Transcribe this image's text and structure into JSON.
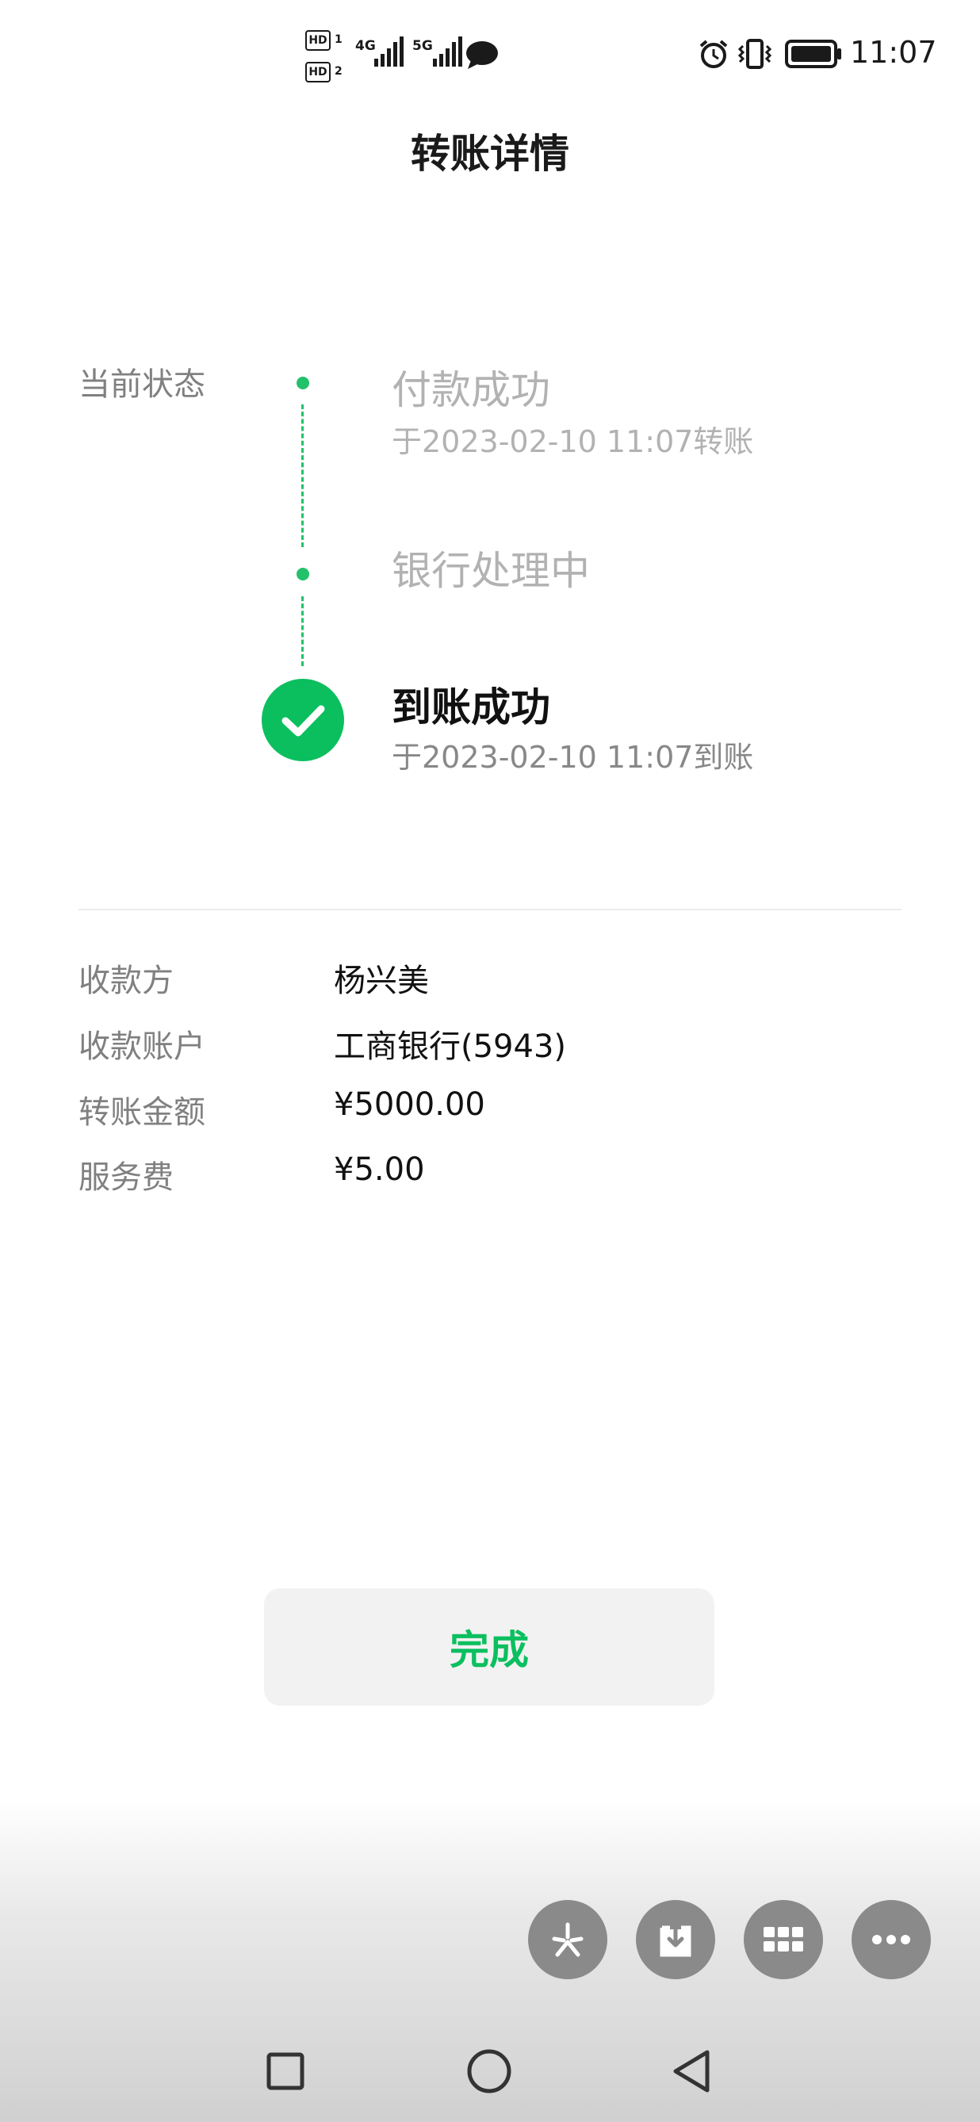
{
  "status_bar": {
    "hd1": "HD",
    "hd1_sub": "1",
    "hd2": "HD",
    "hd2_sub": "2",
    "net1": "4G",
    "net2": "5G",
    "time": "11:07"
  },
  "page": {
    "title": "转账详情"
  },
  "status": {
    "label": "当前状态",
    "steps": [
      {
        "title": "付款成功",
        "subtitle": "于2023-02-10 11:07转账"
      },
      {
        "title": "银行处理中",
        "subtitle": ""
      },
      {
        "title": "到账成功",
        "subtitle": "于2023-02-10 11:07到账"
      }
    ]
  },
  "details": [
    {
      "label": "收款方",
      "value": "杨兴美"
    },
    {
      "label": "收款账户",
      "value": "工商银行(5943)"
    },
    {
      "label": "转账金额",
      "value": "¥5000.00"
    },
    {
      "label": "服务费",
      "value": "¥5.00"
    }
  ],
  "done_button": {
    "label": "完成"
  },
  "colors": {
    "accent": "#0bbf5f",
    "muted_text": "#b2b2b2",
    "label_text": "#808080"
  },
  "floating_icons": [
    "sparkle-icon",
    "download-icon",
    "grid-icon",
    "more-icon"
  ],
  "nav_icons": [
    "recent-apps-icon",
    "home-icon",
    "back-icon"
  ]
}
